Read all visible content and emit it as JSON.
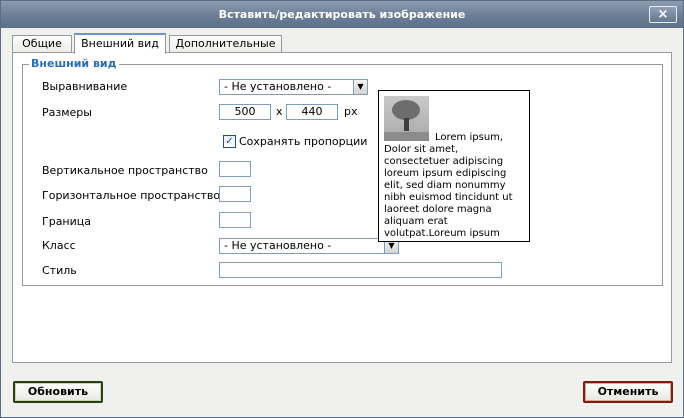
{
  "window": {
    "title": "Вставить/редактировать изображение",
    "close_label": "×"
  },
  "tabs": [
    {
      "label": "Общие"
    },
    {
      "label": "Внешний вид"
    },
    {
      "label": "Дополнительные"
    }
  ],
  "appearance": {
    "legend": "Внешний вид",
    "align": {
      "label": "Выравнивание",
      "value": "- Не установлено -"
    },
    "dimensions": {
      "label": "Размеры",
      "width": "500",
      "separator": "x",
      "height": "440",
      "unit": "px"
    },
    "constrain": {
      "label": "Сохранять пропорции",
      "checked": true,
      "check_glyph": "✓"
    },
    "vspace": {
      "label": "Вертикальное пространство",
      "value": ""
    },
    "hspace": {
      "label": "Горизонтальное пространство",
      "value": ""
    },
    "border": {
      "label": "Граница",
      "value": ""
    },
    "class": {
      "label": "Класс",
      "value": "- Не установлено -"
    },
    "style": {
      "label": "Стиль",
      "value": ""
    },
    "preview_text": "Lorem ipsum, Dolor sit amet, consectetuer adipiscing loreum ipsum edipiscing elit, sed diam nonummy nibh euismod tincidunt ut laoreet dolore magna aliquam erat volutpat.Loreum ipsum"
  },
  "buttons": {
    "update": "Обновить",
    "cancel": "Отменить"
  },
  "icons": {
    "close": "close-icon",
    "dropdown": "chevron-down-icon",
    "check": "checkmark-icon",
    "preview": "image-thumbnail"
  },
  "colors": {
    "titlebar": "#6b7e96",
    "legend": "#2b6fb6",
    "update_border": "#2c3e1b",
    "cancel_border": "#7c1c12"
  }
}
